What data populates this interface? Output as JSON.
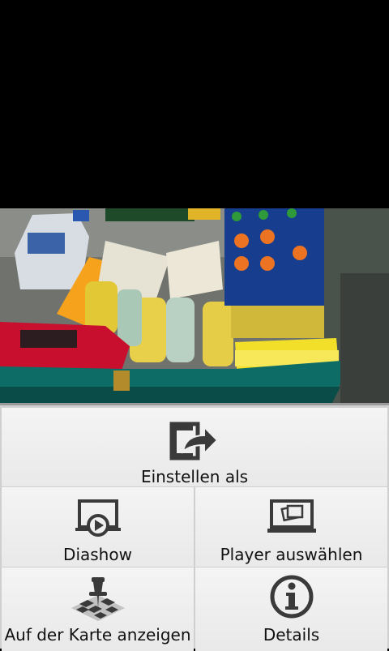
{
  "menu": {
    "set_as": "Einstellen als",
    "slideshow": "Diashow",
    "select_player": "Player auswählen",
    "show_on_map": "Auf der Karte anzeigen",
    "details": "Details"
  },
  "icons": {
    "set_as": "set-as-icon",
    "slideshow": "slideshow-icon",
    "select_player": "select-player-icon",
    "show_on_map": "map-pin-icon",
    "details": "info-icon"
  },
  "colors": {
    "menu_bg": "#efefef",
    "divider": "#cfcfcf",
    "icon": "#3a3a3a",
    "text": "#111111"
  }
}
